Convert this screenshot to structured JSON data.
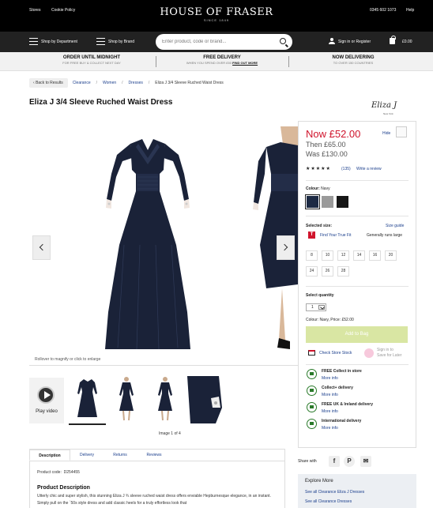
{
  "header": {
    "top_links": [
      "Stores",
      "Cookie Policy"
    ],
    "logo": "HOUSE OF FRASER",
    "logo_sub": "SINCE 1849",
    "phone": "0345 602 1073",
    "help": "Help",
    "nav": {
      "department": "Shop by Department",
      "brand": "Shop by Brand"
    },
    "search": {
      "placeholder": "Enter product, code or brand..."
    },
    "account": "Sign in or Register",
    "basket_total": "£0.00"
  },
  "promo": [
    {
      "title": "ORDER UNTIL MIDNIGHT",
      "sub": "FOR FREE BUY & COLLECT NEXT DAY",
      "link": ""
    },
    {
      "title": "FREE DELIVERY",
      "sub": "WHEN YOU SPEND OVER £50",
      "link": "FIND OUT MORE"
    },
    {
      "title": "NOW DELIVERING",
      "sub": "TO OVER 150 COUNTRIES",
      "link": ""
    }
  ],
  "breadcrumb": {
    "back": "Back to Results",
    "items": [
      "Clearance",
      "Women",
      "Dresses",
      "Eliza J 3/4 Sleeve Ruched Waist Dress"
    ]
  },
  "product": {
    "title": "Eliza J 3/4 Sleeve Ruched Waist Dress",
    "brand_logo": "Eliza J",
    "brand_logo_sub": "New York",
    "rollover_hint": "Rollover to magnify or click to enlarge",
    "play_video": "Play video",
    "image_counter": "Image 1 of 4",
    "code_label": "Product code:",
    "code": "D254455",
    "description_heading": "Product Description",
    "description": "Utterly chic and super stylish, this stunning Eliza J ¾ sleeve ruched waist dress offers enviable Hepburnesque elegance, in an instant. Simply pull on the `50s style dress and add classic heels for a truly effortless look that"
  },
  "tabs": [
    "Description",
    "Delivery",
    "Returns",
    "Reviews"
  ],
  "pricing": {
    "now": "Now £52.00",
    "then": "Then £65.00",
    "was": "Was £130.00",
    "hide": "Hide",
    "stars": "★★★★★",
    "rating": 5,
    "review_count": "(135)",
    "write_review": "Write a review"
  },
  "colour": {
    "label": "Colour:",
    "value": "Navy",
    "swatches": [
      "#1d2a44",
      "#9a9a9a",
      "#161616"
    ]
  },
  "size": {
    "label": "Selected size:",
    "guide": "Size guide",
    "fit_icon": "T",
    "fit_link": "Find Your True Fit",
    "fit_note": "Generally runs large",
    "options": [
      "8",
      "10",
      "12",
      "14",
      "16",
      "20",
      "24",
      "26",
      "28"
    ]
  },
  "quantity": {
    "label": "Select quantity",
    "value": "1"
  },
  "summary": "Colour: Navy, Price: £52.00",
  "add_to_bag": "Add to Bag",
  "store_stock": "Check Store Stock",
  "sign_in_save": [
    "Sign in to",
    "Save for Later"
  ],
  "delivery_options": [
    {
      "title": "FREE Collect in store",
      "more": "More info"
    },
    {
      "title": "Collect+ delivery",
      "more": "More info"
    },
    {
      "title": "FREE UK & Ireland delivery",
      "more": "More info"
    },
    {
      "title": "International delivery",
      "more": "More info"
    }
  ],
  "share": {
    "label": "Share with",
    "networks": [
      "f",
      "P",
      "✉"
    ]
  },
  "explore": {
    "heading": "Explore More",
    "links": [
      "See all Clearance Eliza J Dresses",
      "See all Clearance Dresses"
    ]
  }
}
